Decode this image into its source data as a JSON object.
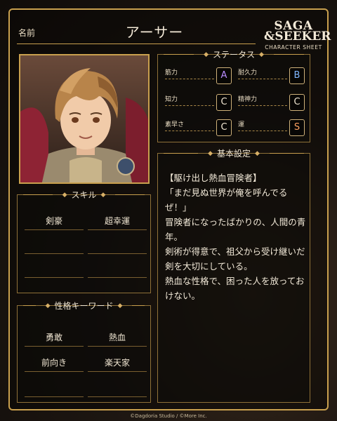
{
  "header": {
    "name_label": "名前",
    "character_name": "アーサー",
    "logo_line1": "SAGA",
    "logo_line2": "&SEEKER",
    "logo_line3": "CHARACTER SHEET"
  },
  "status": {
    "title": "ステータス",
    "items": [
      {
        "label": "筋力",
        "grade": "A",
        "color": "#b98cff"
      },
      {
        "label": "耐久力",
        "grade": "B",
        "color": "#7fb6ff"
      },
      {
        "label": "知力",
        "grade": "C",
        "color": "#f0e6d2"
      },
      {
        "label": "精神力",
        "grade": "C",
        "color": "#f0e6d2"
      },
      {
        "label": "素早さ",
        "grade": "C",
        "color": "#f0e6d2"
      },
      {
        "label": "運",
        "grade": "S",
        "color": "#ffa060"
      }
    ]
  },
  "settings": {
    "title": "基本設定",
    "lines": [
      "【駆け出し熱血冒険者】",
      "「まだ見ぬ世界が俺を呼んでるぜ！」",
      "冒険者になったばかりの、人間の青年。",
      "剣術が得意で、祖父から受け継いだ剣を大切にしている。",
      "熱血な性格で、困った人を放っておけない。"
    ]
  },
  "skills": {
    "title": "スキル",
    "items": [
      "剣豪",
      "超幸運",
      "",
      "",
      "",
      ""
    ]
  },
  "traits": {
    "title": "性格キーワード",
    "items": [
      "勇敢",
      "熱血",
      "前向き",
      "楽天家",
      "",
      ""
    ]
  },
  "footer": {
    "copyright": "©Dagdoria Studio / ©More Inc."
  },
  "colors": {
    "frame_gold": "#c9a04e",
    "grade_a": "#b98cff",
    "grade_b": "#7fb6ff",
    "grade_s": "#ffa060"
  }
}
